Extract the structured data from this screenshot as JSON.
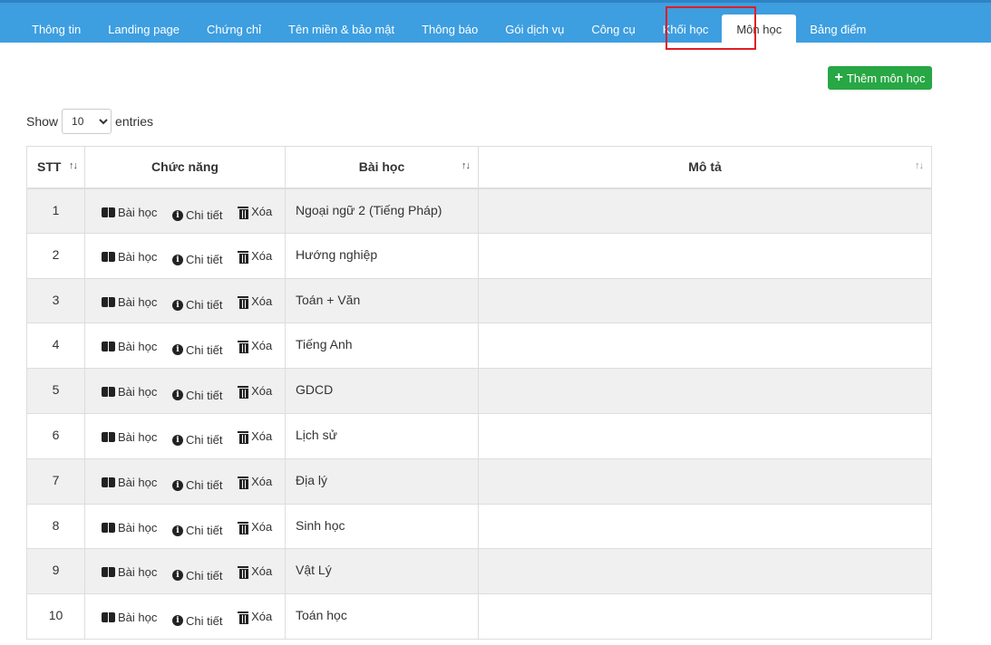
{
  "tabs": [
    {
      "label": "Thông tin",
      "active": false
    },
    {
      "label": "Landing page",
      "active": false
    },
    {
      "label": "Chứng chỉ",
      "active": false
    },
    {
      "label": "Tên miền & bảo mật",
      "active": false
    },
    {
      "label": "Thông báo",
      "active": false
    },
    {
      "label": "Gói dịch vụ",
      "active": false
    },
    {
      "label": "Công cụ",
      "active": false
    },
    {
      "label": "Khối học",
      "active": false
    },
    {
      "label": "Môn học",
      "active": true
    },
    {
      "label": "Bảng điểm",
      "active": false
    }
  ],
  "add_button": {
    "label": "Thêm môn học"
  },
  "length": {
    "show": "Show",
    "value": "10",
    "entries": "entries"
  },
  "table": {
    "headers": {
      "stt": "STT",
      "fn": "Chức năng",
      "name": "Bài học",
      "desc": "Mô tả"
    },
    "actions": {
      "lessons": "Bài học",
      "detail": "Chi tiết",
      "delete": "Xóa"
    },
    "rows": [
      {
        "stt": "1",
        "name": "Ngoại ngữ 2 (Tiếng Pháp)",
        "desc": ""
      },
      {
        "stt": "2",
        "name": "Hướng nghiệp",
        "desc": ""
      },
      {
        "stt": "3",
        "name": "Toán + Văn",
        "desc": ""
      },
      {
        "stt": "4",
        "name": "Tiếng Anh",
        "desc": ""
      },
      {
        "stt": "5",
        "name": "GDCD",
        "desc": ""
      },
      {
        "stt": "6",
        "name": "Lịch sử",
        "desc": ""
      },
      {
        "stt": "7",
        "name": "Địa lý",
        "desc": ""
      },
      {
        "stt": "8",
        "name": "Sinh học",
        "desc": ""
      },
      {
        "stt": "9",
        "name": "Vật Lý",
        "desc": ""
      },
      {
        "stt": "10",
        "name": "Toán học",
        "desc": ""
      }
    ]
  },
  "colors": {
    "topbar": "#3d9ee0",
    "add_button": "#28a745",
    "highlight": "#e11d24"
  }
}
